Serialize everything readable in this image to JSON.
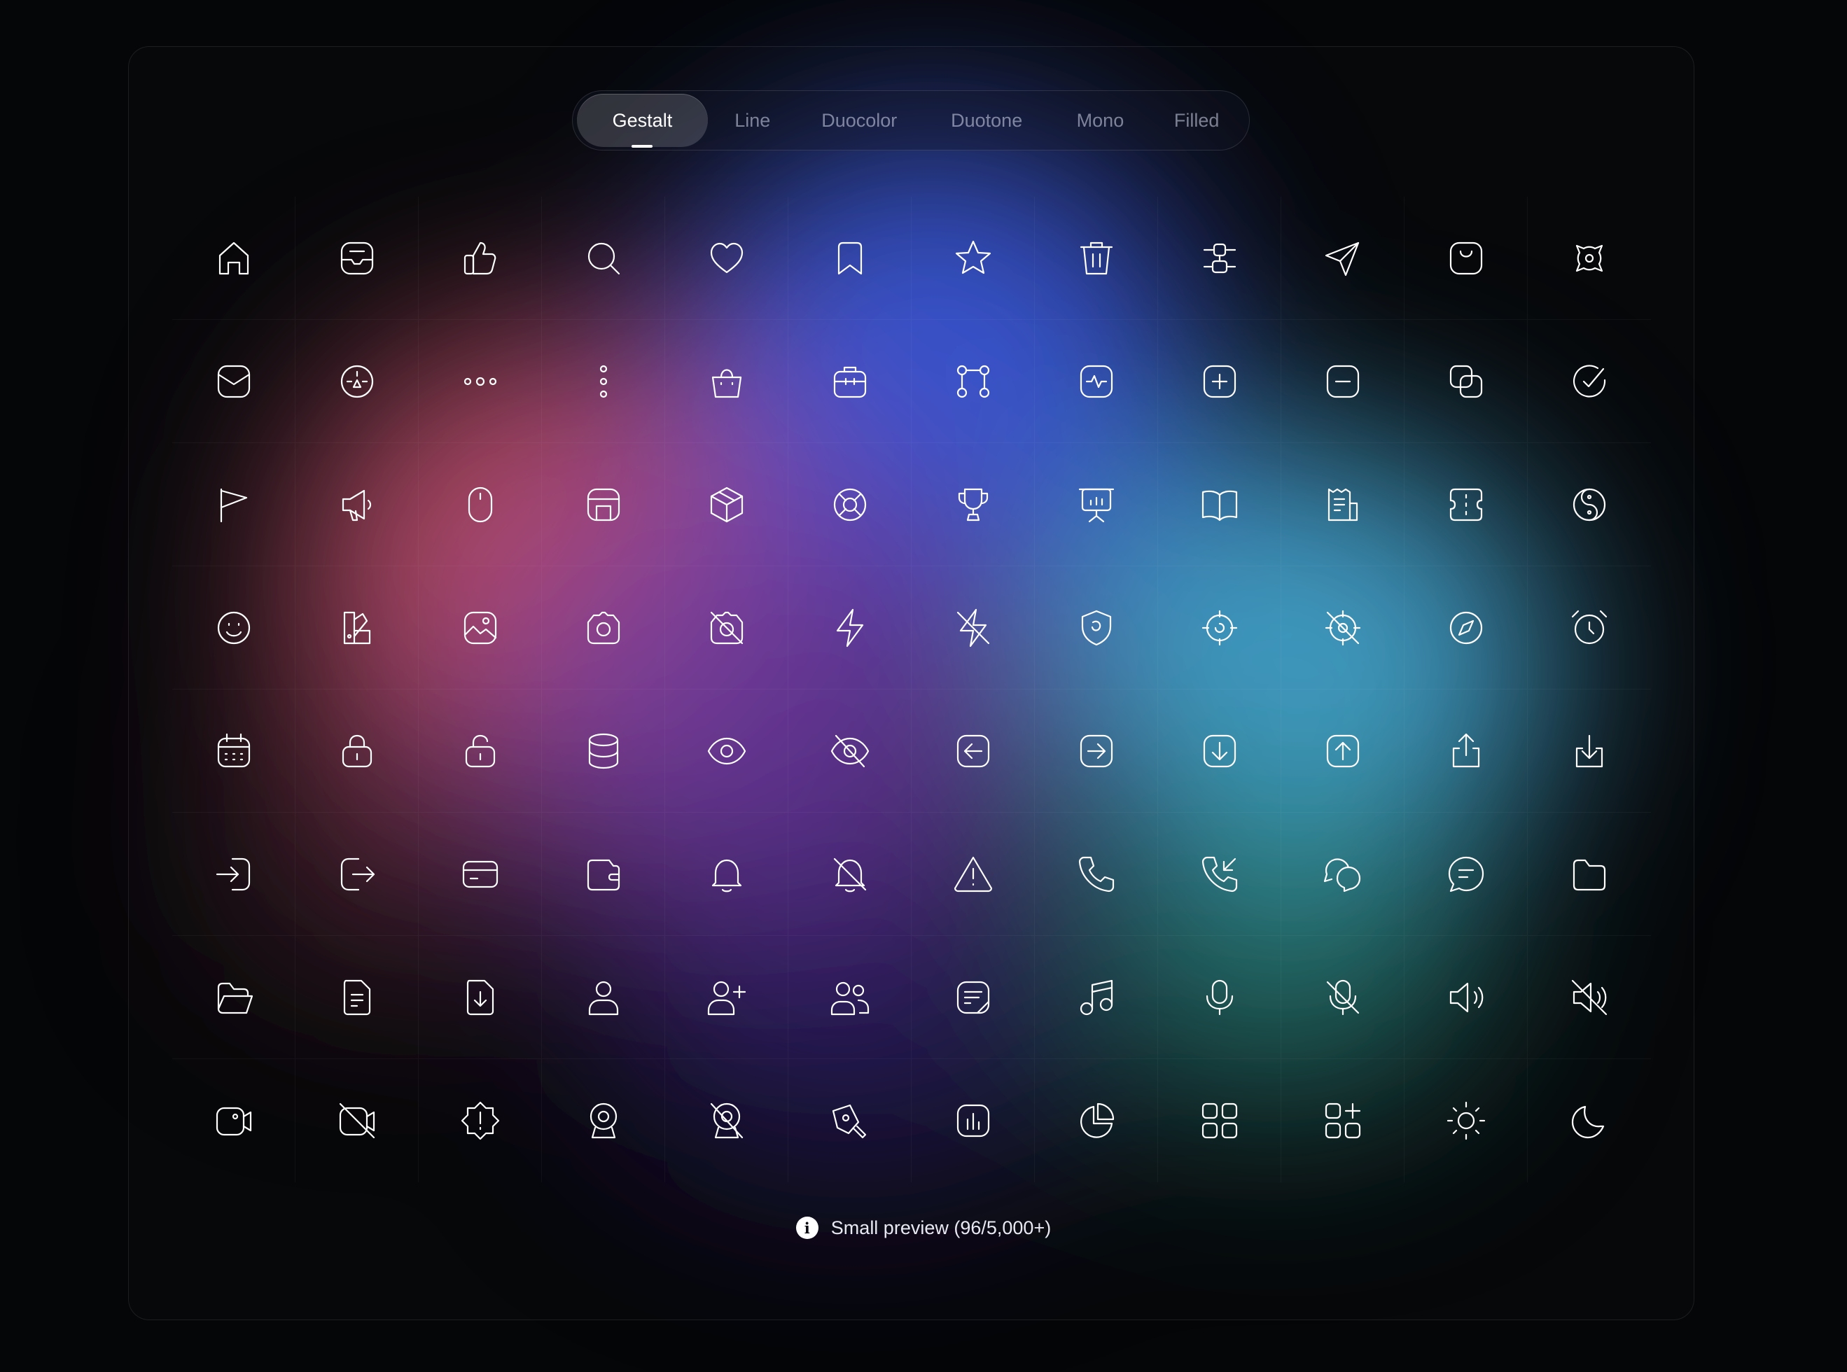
{
  "tabs": [
    {
      "label": "Gestalt",
      "active": true
    },
    {
      "label": "Line"
    },
    {
      "label": "Duocolor"
    },
    {
      "label": "Duotone"
    },
    {
      "label": "Mono"
    },
    {
      "label": "Filled"
    }
  ],
  "icons": [
    "home-icon",
    "inbox-tray-icon",
    "thumbs-up-icon",
    "search-icon",
    "heart-icon",
    "bookmark-icon",
    "star-icon",
    "trash-icon",
    "align-vertical-icon",
    "send-icon",
    "shopping-bag-icon",
    "move-icon",
    "mail-icon",
    "speedometer-icon",
    "more-horizontal-icon",
    "more-vertical-icon",
    "basket-icon",
    "briefcase-icon",
    "git-branch-icon",
    "activity-icon",
    "plus-square-icon",
    "minus-square-icon",
    "copy-icon",
    "check-circle-icon",
    "flag-icon",
    "megaphone-icon",
    "mouse-icon",
    "cabinet-icon",
    "box-icon",
    "life-buoy-icon",
    "trophy-icon",
    "presentation-icon",
    "book-open-icon",
    "receipt-icon",
    "ticket-icon",
    "yin-yang-icon",
    "smile-icon",
    "palette-icon",
    "image-icon",
    "camera-icon",
    "camera-off-icon",
    "zap-icon",
    "zap-off-icon",
    "shield-icon",
    "target-icon",
    "target-off-icon",
    "compass-icon",
    "alarm-clock-icon",
    "calendar-icon",
    "lock-icon",
    "unlock-icon",
    "database-icon",
    "eye-icon",
    "eye-off-icon",
    "arrow-left-square-icon",
    "arrow-right-square-icon",
    "arrow-down-square-icon",
    "arrow-up-square-icon",
    "share-icon",
    "download-icon",
    "log-in-icon",
    "log-out-icon",
    "card-icon",
    "wallet-icon",
    "bell-icon",
    "bell-off-icon",
    "alert-triangle-icon",
    "phone-icon",
    "phone-incoming-icon",
    "chat-bubbles-icon",
    "message-circle-icon",
    "folder-icon",
    "folder-open-icon",
    "file-icon",
    "file-download-icon",
    "user-icon",
    "user-plus-icon",
    "users-icon",
    "note-icon",
    "music-icon",
    "microphone-icon",
    "microphone-off-icon",
    "volume-icon",
    "volume-off-icon",
    "video-icon",
    "video-off-icon",
    "alert-badge-icon",
    "webcam-icon",
    "webcam-off-icon",
    "pen-tool-icon",
    "bar-chart-icon",
    "pie-chart-icon",
    "grid-icon",
    "grid-plus-icon",
    "sun-icon",
    "moon-icon"
  ],
  "caption": {
    "text": "Small preview (96/5,000+)",
    "info_icon": "info-icon"
  },
  "colors": {
    "background": "#050608",
    "icon": "#ffffff",
    "accent_red": "#c8506e",
    "accent_blue": "#3d5ce0",
    "accent_cyan": "#4fb4e0",
    "accent_teal": "#2c8a82"
  }
}
